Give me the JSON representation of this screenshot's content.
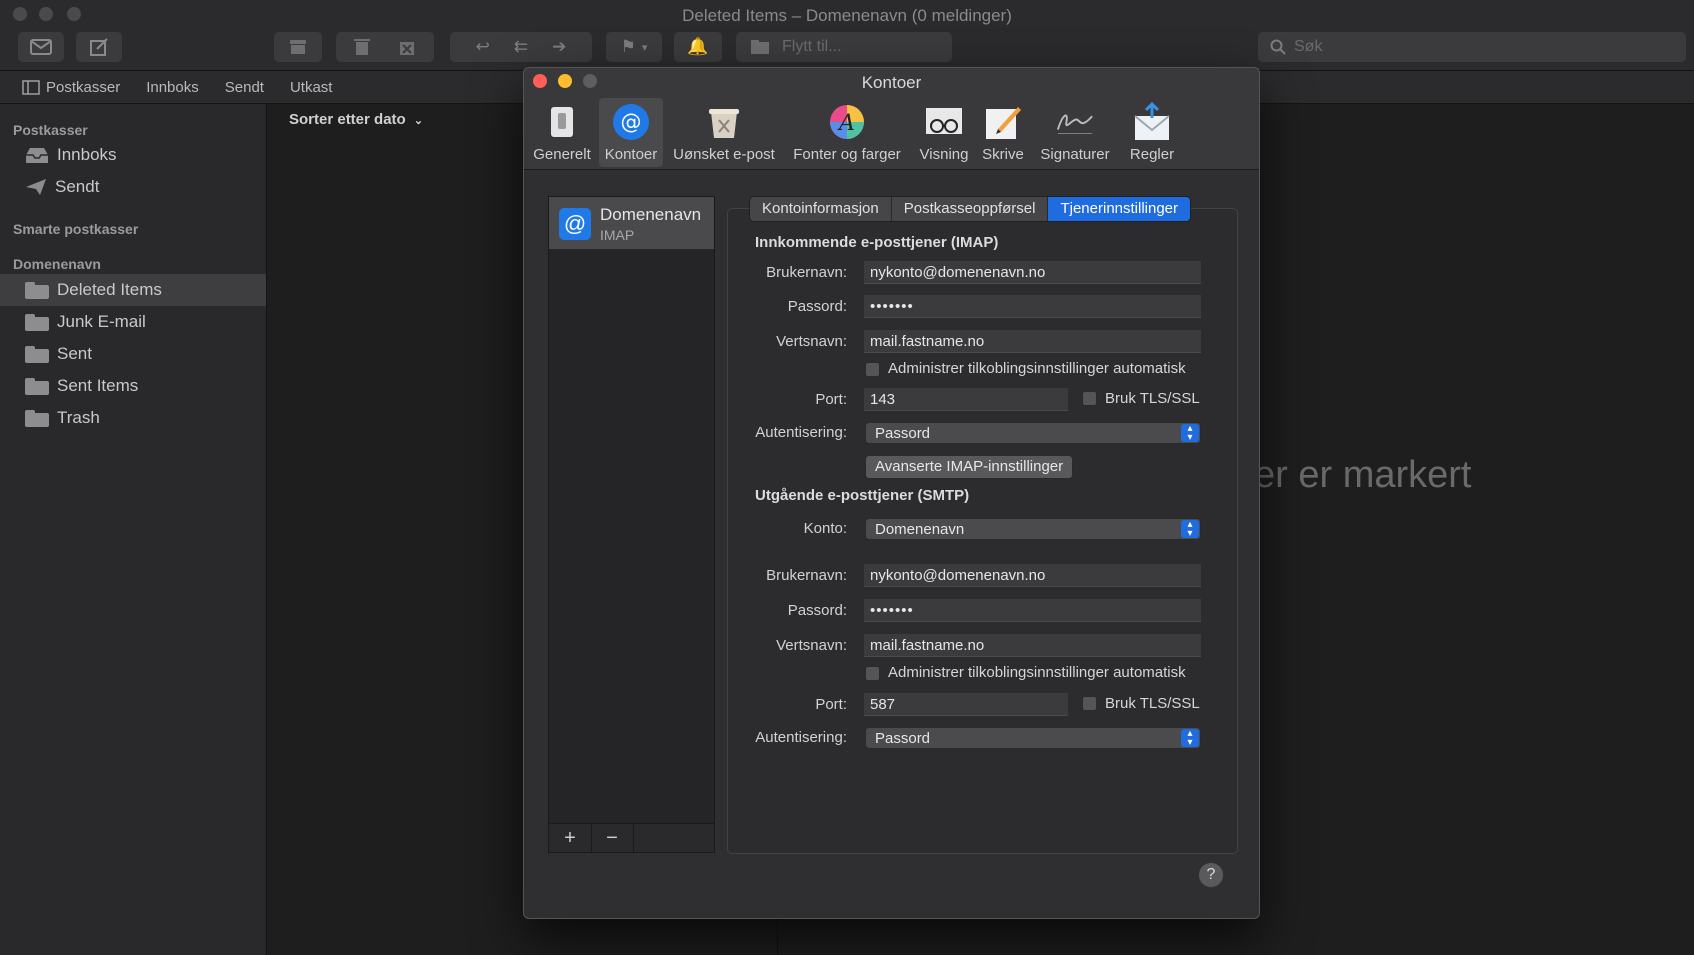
{
  "window": {
    "title": "Deleted Items – Domenenavn (0 meldinger)"
  },
  "toolbar": {
    "move_to_label": "Flytt til...",
    "search_placeholder": "Søk"
  },
  "favorites": [
    "Postkasser",
    "Innboks",
    "Sendt",
    "Utkast"
  ],
  "sidebar": {
    "section_mailboxes": "Postkasser",
    "mailboxes": [
      "Innboks",
      "Sendt"
    ],
    "section_smart": "Smarte postkasser",
    "section_account": "Domenenavn",
    "folders": [
      "Deleted Items",
      "Junk E-mail",
      "Sent",
      "Sent Items",
      "Trash"
    ],
    "selected_folder": "Deleted Items"
  },
  "message_list": {
    "sort_label": "Sorter etter dato"
  },
  "viewer": {
    "empty_text": "er er markert"
  },
  "preferences": {
    "title": "Kontoer",
    "tabs": [
      {
        "label": "Generelt",
        "icon": "switch-icon"
      },
      {
        "label": "Kontoer",
        "icon": "at-icon"
      },
      {
        "label": "Uønsket e-post",
        "icon": "junk-bin-icon"
      },
      {
        "label": "Fonter og farger",
        "icon": "color-font-icon"
      },
      {
        "label": "Visning",
        "icon": "glasses-icon"
      },
      {
        "label": "Skrive",
        "icon": "pencil-paper-icon"
      },
      {
        "label": "Signaturer",
        "icon": "signature-icon"
      },
      {
        "label": "Regler",
        "icon": "rules-envelope-icon"
      }
    ],
    "active_tab": "Kontoer",
    "account": {
      "name": "Domenenavn",
      "type": "IMAP"
    },
    "segments": [
      "Kontoinformasjon",
      "Postkasseoppførsel",
      "Tjenerinnstillinger"
    ],
    "active_segment": "Tjenerinnstillinger",
    "incoming": {
      "title": "Innkommende e-posttjener (IMAP)",
      "username_label": "Brukernavn:",
      "username": "nykonto@domenenavn.no",
      "password_label": "Passord:",
      "password": "•••••••",
      "host_label": "Vertsnavn:",
      "host": "mail.fastname.no",
      "auto_manage_label": "Administrer tilkoblingsinnstillinger automatisk",
      "port_label": "Port:",
      "port": "143",
      "tls_label": "Bruk TLS/SSL",
      "auth_label": "Autentisering:",
      "auth": "Passord",
      "advanced_button": "Avanserte IMAP-innstillinger"
    },
    "outgoing": {
      "title": "Utgående e-posttjener (SMTP)",
      "account_label": "Konto:",
      "account": "Domenenavn",
      "username_label": "Brukernavn:",
      "username": "nykonto@domenenavn.no",
      "password_label": "Passord:",
      "password": "•••••••",
      "host_label": "Vertsnavn:",
      "host": "mail.fastname.no",
      "auto_manage_label": "Administrer tilkoblingsinnstillinger automatisk",
      "port_label": "Port:",
      "port": "587",
      "tls_label": "Bruk TLS/SSL",
      "auth_label": "Autentisering:",
      "auth": "Passord"
    },
    "add_label": "+",
    "remove_label": "−",
    "help_label": "?"
  },
  "colors": {
    "accent": "#1f6be0",
    "close": "#fe5f57",
    "minimize": "#febc2e"
  }
}
